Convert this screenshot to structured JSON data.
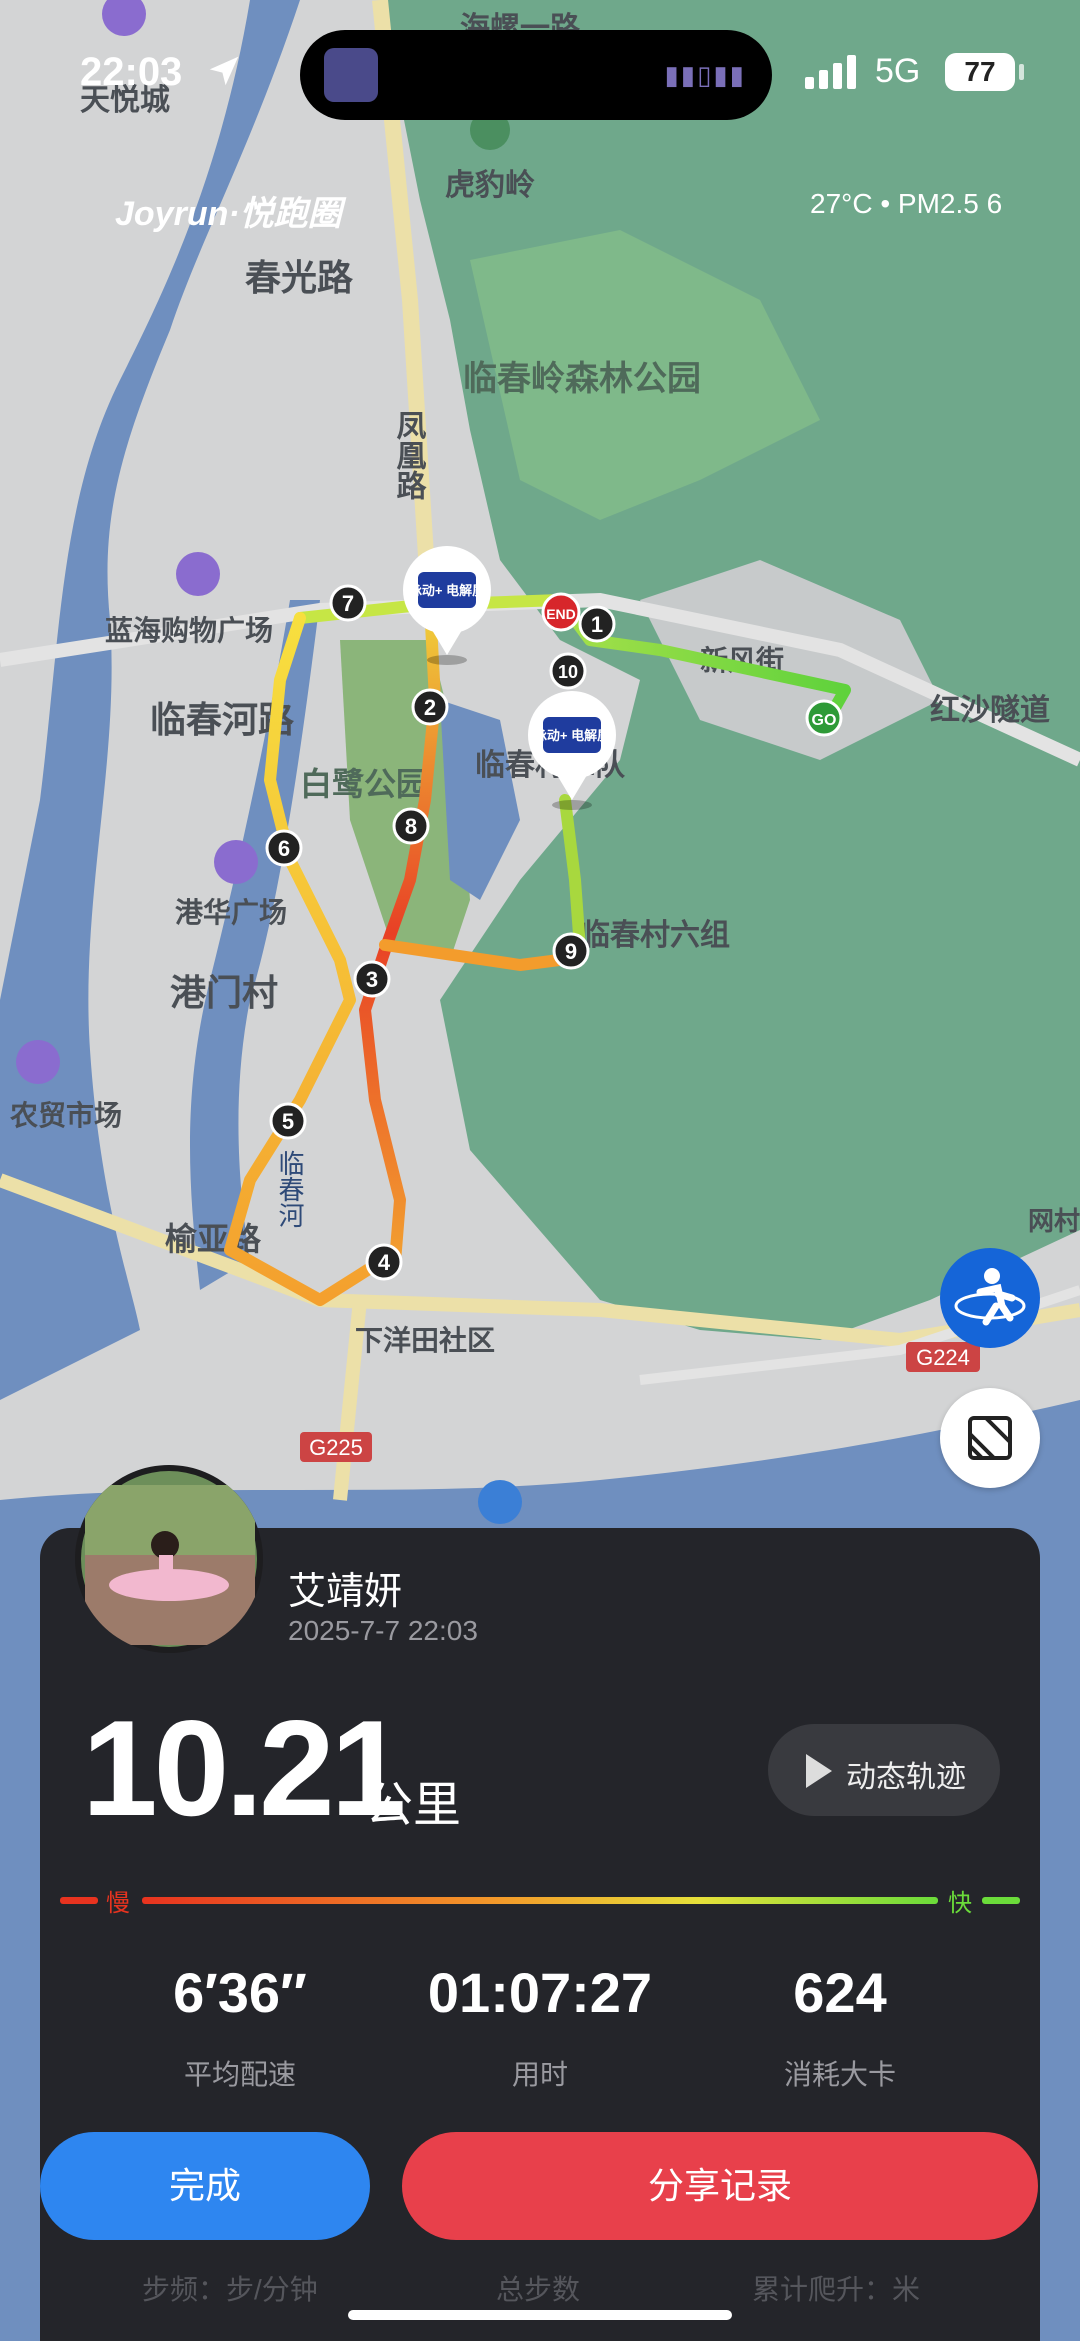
{
  "status_bar": {
    "time": "22:03",
    "network": "5G",
    "battery": "77"
  },
  "brand": "Joyrun·悦跑圈",
  "weather": "27°C • PM2.5 6",
  "map_labels": {
    "hongshan": "海螺一路",
    "tianyue": "天悦城",
    "hupu": "虎豹岭",
    "chunguang": "春光路",
    "forest_park": "临春岭森林公园",
    "fenghuang": "凤凰路",
    "lanhai": "蓝海购物广场",
    "linchunhe": "临春河路",
    "bailu": "白鹭公园",
    "xinfeng": "新风街",
    "hongsha": "红沙隧道",
    "linchun2": "临春村二队",
    "linchun6": "临春村六组",
    "ganghua": "港华广场",
    "gangmen": "港门村",
    "nongmao": "农贸市场",
    "river": "临春河",
    "yuya": "榆亚路",
    "xiayang": "下洋田社区",
    "g225": "G225",
    "g224": "G224",
    "wangcun": "网村"
  },
  "markers": {
    "end": "END",
    "go": "GO",
    "sponsor": "脉动+ 电解质",
    "km": [
      "1",
      "2",
      "3",
      "4",
      "5",
      "6",
      "7",
      "8",
      "9",
      "10"
    ]
  },
  "user": {
    "name": "艾靖妍",
    "datetime": "2025-7-7 22:03"
  },
  "distance": {
    "value": "10.21",
    "unit": "公里"
  },
  "dynamic_track_label": "动态轨迹",
  "pace_scale": {
    "slow": "慢",
    "fast": "快"
  },
  "stats": [
    {
      "value": "6′36″",
      "label": "平均配速"
    },
    {
      "value": "01:07:27",
      "label": "用时"
    },
    {
      "value": "624",
      "label": "消耗大卡"
    }
  ],
  "buttons": {
    "done": "完成",
    "share": "分享记录"
  },
  "bottom_labels": [
    "步频：步/分钟",
    "总步数",
    "累计爬升：米"
  ],
  "colors": {
    "route_slow": "#e8331f",
    "route_mid": "#f5c22a",
    "route_fast": "#7ddc3a",
    "accent_blue": "#2e86f0",
    "accent_red": "#e8404b"
  }
}
